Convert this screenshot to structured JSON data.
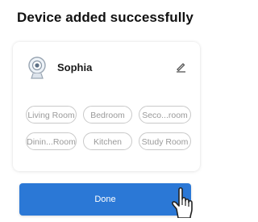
{
  "title": "Device added successfully",
  "device": {
    "name": "Sophia",
    "icon": "camera-icon",
    "edit_icon": "pencil-icon"
  },
  "rooms": [
    {
      "label": "Living Room"
    },
    {
      "label": "Bedroom"
    },
    {
      "label": "Seco...room"
    },
    {
      "label": "Dinin...Room"
    },
    {
      "label": "Kitchen"
    },
    {
      "label": "Study Room"
    }
  ],
  "done_button": {
    "label": "Done",
    "pointer_icon": "hand-pointer-icon"
  },
  "colors": {
    "accent": "#2b78d6",
    "chip_border": "#c9c9c9",
    "chip_text": "#9a9a9a"
  }
}
